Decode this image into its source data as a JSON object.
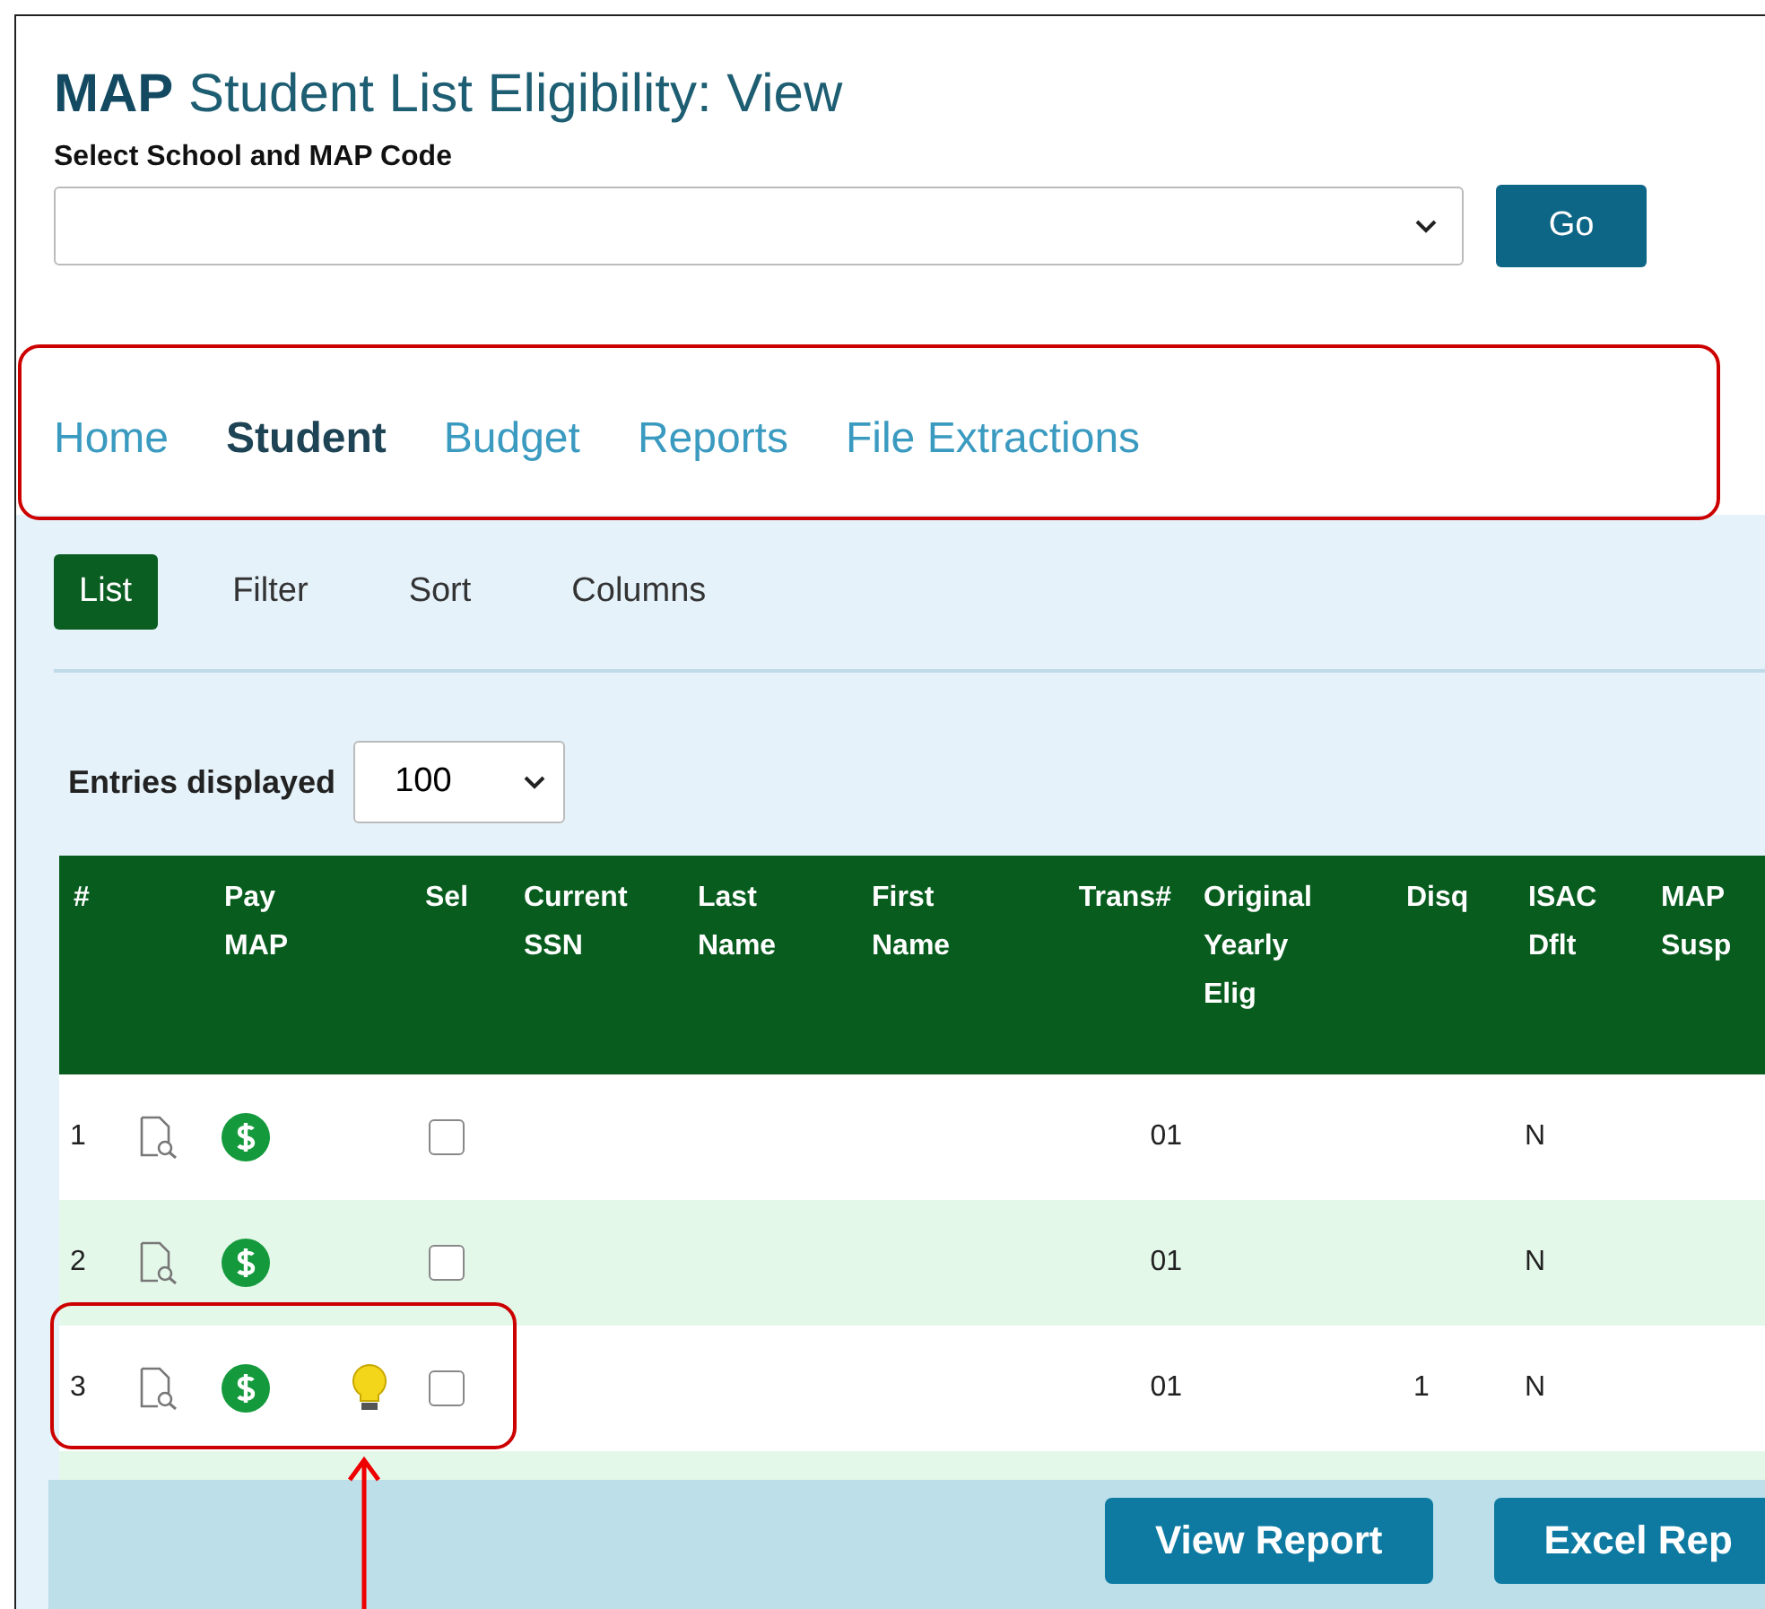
{
  "page_title": {
    "brand": "MAP",
    "title": "Student List Eligibility: View"
  },
  "school_select": {
    "label": "Select School and MAP Code"
  },
  "go_button": "Go",
  "nav_tabs": [
    {
      "label": "Home",
      "selected": false
    },
    {
      "label": "Student",
      "selected": true
    },
    {
      "label": "Budget",
      "selected": false
    },
    {
      "label": "Reports",
      "selected": false
    },
    {
      "label": "File Extractions",
      "selected": false
    }
  ],
  "sub_tabs": [
    {
      "label": "List",
      "selected": true
    },
    {
      "label": "Filter",
      "selected": false
    },
    {
      "label": "Sort",
      "selected": false
    },
    {
      "label": "Columns",
      "selected": false
    }
  ],
  "entries": {
    "label": "Entries displayed",
    "value": "100"
  },
  "table": {
    "columns": [
      "#",
      "",
      "Pay MAP",
      "",
      "Sel",
      "Current SSN",
      "Last Name",
      "First Name",
      "Trans#",
      "Original Yearly Elig",
      "Disq",
      "ISAC Dflt",
      "MAP Susp"
    ],
    "rows": [
      {
        "number": "1",
        "bulb": false,
        "checked": false,
        "trans": "01",
        "disq": "",
        "isac_dflt": "N"
      },
      {
        "number": "2",
        "bulb": false,
        "checked": false,
        "trans": "01",
        "disq": "",
        "isac_dflt": "N"
      },
      {
        "number": "3",
        "bulb": true,
        "checked": false,
        "trans": "01",
        "disq": "1",
        "isac_dflt": "N"
      }
    ]
  },
  "footer_buttons": [
    "View Report",
    "Excel Rep"
  ]
}
